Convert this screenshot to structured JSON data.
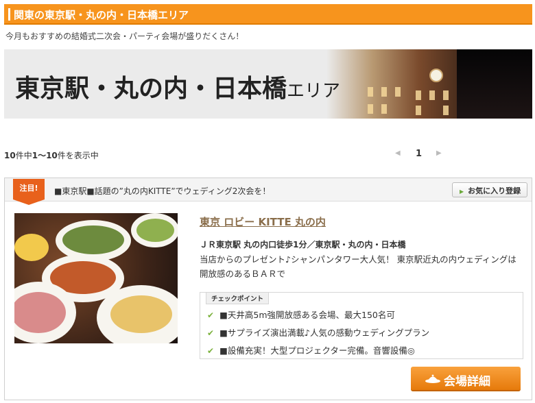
{
  "header": {
    "title": "関東の東京駅・丸の内・日本橋エリア"
  },
  "intro": "今月もおすすめの結婚式二次会・パーティ会場が盛りだくさん！",
  "banner": {
    "main": "東京駅・丸の内・日本橋",
    "suffix": "エリア"
  },
  "results": {
    "total": "10",
    "range": "1〜10",
    "pre": "件中",
    "post": "件を表示中"
  },
  "pager": {
    "current": "1",
    "prev": "◀",
    "next": "▶"
  },
  "listing": {
    "flag": "注目!",
    "catch": "■東京駅■話題の”丸の内KITTE”でウェディング2次会を！",
    "favorite": "お気に入り登録",
    "name": "東京 ロビー KITTE 丸の内",
    "access": "ＪＲ東京駅 丸の内口徒歩1分／東京駅・丸の内・日本橋",
    "description": "当店からのプレゼント♪シャンパンタワー大人気！ 東京駅近丸の内ウェディングは開放感のあるＢＡＲで",
    "checkpoint_label": "チェックポイント",
    "points": [
      "■天井高5m強開放感ある会場、最大150名可",
      "■サプライズ演出満載♪人気の感動ウェディングプラン",
      "■設備充実！大型プロジェクター完備。音響設備◎"
    ],
    "detail_button": "会場詳細"
  },
  "colors": {
    "accent": "#f7941d",
    "flag": "#e8611c",
    "link": "#8a6e4b",
    "check": "#7bb13c"
  }
}
